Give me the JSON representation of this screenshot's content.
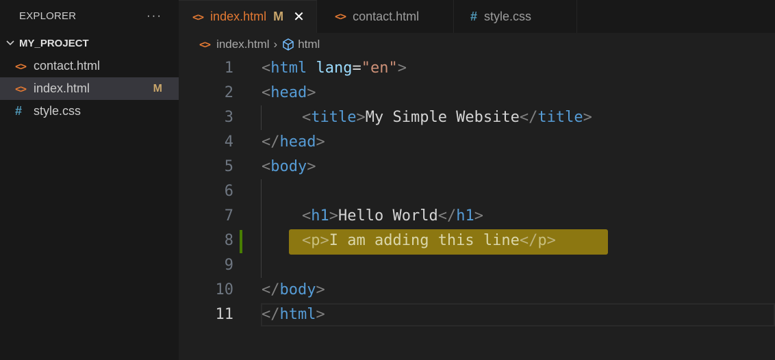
{
  "sidebar": {
    "title": "EXPLORER",
    "more": "···",
    "folder": "MY_PROJECT",
    "files": [
      {
        "name": "contact.html",
        "icon": "html-file-icon",
        "icon_glyph": "<>",
        "modified": ""
      },
      {
        "name": "index.html",
        "icon": "html-file-icon",
        "icon_glyph": "<>",
        "modified": "M"
      },
      {
        "name": "style.css",
        "icon": "css-file-icon",
        "icon_glyph": "#",
        "modified": ""
      }
    ]
  },
  "tabs": [
    {
      "label": "index.html",
      "glyph": "<>",
      "modified": "M",
      "close": "✕"
    },
    {
      "label": "contact.html",
      "glyph": "<>"
    },
    {
      "label": "style.css",
      "glyph": "#"
    }
  ],
  "breadcrumb": {
    "file": "index.html",
    "glyph": "<>",
    "separator": "›",
    "symbol": "html"
  },
  "editor": {
    "line_numbers": [
      "1",
      "2",
      "3",
      "4",
      "5",
      "6",
      "7",
      "8",
      "9",
      "10",
      "11"
    ],
    "active_line": "11",
    "lines": {
      "l1": {
        "lt": "<",
        "tag": "html",
        "attr": "lang",
        "eq": "=",
        "val": "\"en\"",
        "gt": ">"
      },
      "l2": {
        "lt": "<",
        "tag": "head",
        "gt": ">"
      },
      "l3": {
        "lt": "<",
        "tag": "title",
        "gt": ">",
        "text": "My Simple Website",
        "close_lt": "</",
        "close_tag": "title",
        "close_gt": ">"
      },
      "l4": {
        "lt": "</",
        "tag": "head",
        "gt": ">"
      },
      "l5": {
        "lt": "<",
        "tag": "body",
        "gt": ">"
      },
      "l7": {
        "lt": "<",
        "tag": "h1",
        "gt": ">",
        "text": "Hello World",
        "close_lt": "</",
        "close_tag": "h1",
        "close_gt": ">"
      },
      "l8": {
        "lt": "<",
        "tag": "p",
        "gt": ">",
        "text": "I am adding this line",
        "close_lt": "</",
        "close_tag": "p",
        "close_gt": ">"
      },
      "l10": {
        "lt": "</",
        "tag": "body",
        "gt": ">"
      },
      "l11": {
        "lt": "</",
        "tag": "html",
        "gt": ">"
      }
    }
  },
  "colors": {
    "highlight": "#8c7711",
    "html_icon": "#e37933",
    "css_icon": "#519aba",
    "modified": "#c9a66b",
    "gutter_modified": "#487e02"
  }
}
